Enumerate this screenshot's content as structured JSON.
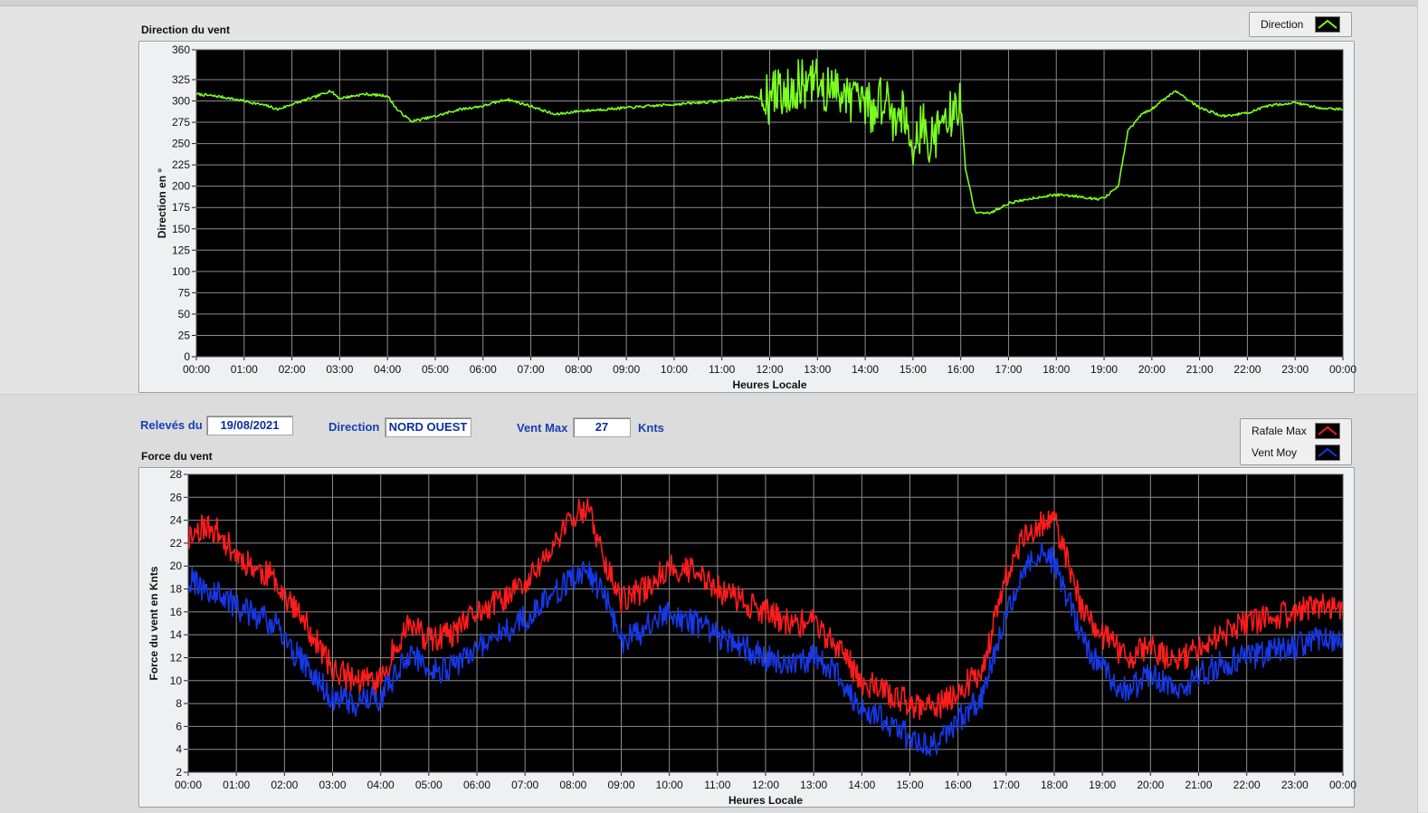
{
  "chart_data": [
    {
      "type": "line",
      "title": "Direction du vent",
      "xlabel": "Heures Locale",
      "ylabel": "Direction en °",
      "ylim": [
        0,
        360
      ],
      "yticks": [
        0,
        25,
        50,
        75,
        100,
        125,
        150,
        175,
        200,
        225,
        250,
        275,
        300,
        325,
        360
      ],
      "xticks": [
        "00:00",
        "01:00",
        "02:00",
        "03:00",
        "04:00",
        "05:00",
        "06:00",
        "07:00",
        "08:00",
        "09:00",
        "10:00",
        "11:00",
        "12:00",
        "13:00",
        "14:00",
        "15:00",
        "16:00",
        "17:00",
        "18:00",
        "19:00",
        "20:00",
        "21:00",
        "22:00",
        "23:00",
        "00:00"
      ],
      "xlim": [
        0,
        24
      ],
      "grid": true,
      "legend": "top-right",
      "series": [
        {
          "name": "Direction",
          "color": "#7cff1e",
          "x": [
            0,
            0.5,
            1,
            1.5,
            1.7,
            2,
            2.5,
            2.8,
            3,
            3.5,
            4,
            4.2,
            4.5,
            5,
            5.5,
            6,
            6.5,
            7,
            7.5,
            8,
            8.5,
            9,
            9.5,
            10,
            10.5,
            11,
            11.5,
            12,
            12.2,
            12.5,
            13,
            13.3,
            13.6,
            13.8,
            14,
            14.2,
            14.4,
            14.6,
            14.8,
            15,
            15.2,
            15.4,
            15.6,
            15.8,
            15.95,
            16,
            16.1,
            16.3,
            16.6,
            17,
            17.5,
            18,
            18.5,
            18.8,
            19,
            19.3,
            19.5,
            19.8,
            20,
            20.2,
            20.5,
            21,
            21.5,
            22,
            22.5,
            23,
            23.5,
            24
          ],
          "values": [
            308,
            305,
            300,
            294,
            290,
            296,
            305,
            312,
            303,
            308,
            306,
            290,
            276,
            282,
            290,
            294,
            302,
            294,
            284,
            288,
            290,
            292,
            294,
            296,
            298,
            300,
            305,
            302,
            312,
            318,
            320,
            310,
            315,
            295,
            300,
            285,
            310,
            280,
            290,
            255,
            270,
            252,
            275,
            282,
            290,
            300,
            220,
            170,
            168,
            180,
            186,
            190,
            188,
            185,
            186,
            200,
            265,
            285,
            290,
            300,
            312,
            292,
            282,
            286,
            295,
            298,
            292,
            290
          ]
        }
      ]
    },
    {
      "type": "line",
      "title": "Force du vent",
      "xlabel": "Heures Locale",
      "ylabel": "Force du vent en Knts",
      "ylim": [
        2,
        28
      ],
      "yticks": [
        2,
        4,
        6,
        8,
        10,
        12,
        14,
        16,
        18,
        20,
        22,
        24,
        26,
        28
      ],
      "xticks": [
        "00:00",
        "01:00",
        "02:00",
        "03:00",
        "04:00",
        "05:00",
        "06:00",
        "07:00",
        "08:00",
        "09:00",
        "10:00",
        "11:00",
        "12:00",
        "13:00",
        "14:00",
        "15:00",
        "16:00",
        "17:00",
        "18:00",
        "19:00",
        "20:00",
        "21:00",
        "22:00",
        "23:00",
        "00:00"
      ],
      "xlim": [
        0,
        24
      ],
      "grid": true,
      "legend": "top-right",
      "series": [
        {
          "name": "Rafale Max",
          "color": "#ff1c1c",
          "x": [
            0,
            0.3,
            0.6,
            1,
            1.5,
            1.8,
            2,
            2.5,
            3,
            3.5,
            4,
            4.3,
            4.6,
            5,
            5.5,
            6,
            6.5,
            7,
            7.5,
            8,
            8.3,
            8.7,
            9,
            9.5,
            10,
            10.5,
            11,
            11.5,
            12,
            12.5,
            13,
            13.5,
            14,
            14.5,
            15,
            15.5,
            16,
            16.5,
            17,
            17.3,
            17.6,
            18,
            18.3,
            18.6,
            19,
            19.5,
            20,
            20.5,
            21,
            21.5,
            22,
            22.5,
            23,
            23.5,
            24
          ],
          "values": [
            22.5,
            23.5,
            23,
            21,
            19.5,
            19,
            17.5,
            14.5,
            11,
            10,
            10,
            13,
            15,
            13.5,
            14,
            16,
            17,
            18.5,
            21,
            24.5,
            25,
            20,
            17,
            18,
            20,
            19.5,
            18,
            17,
            16,
            15,
            15,
            13,
            10,
            9,
            8,
            7.5,
            9,
            11,
            19,
            22,
            23.5,
            24,
            20,
            16,
            14,
            12,
            13,
            11.5,
            13,
            14,
            15,
            15.5,
            16,
            16.5,
            16
          ]
        },
        {
          "name": "Vent Moy",
          "color": "#1638e6",
          "x": [
            0,
            0.3,
            0.6,
            1,
            1.5,
            1.8,
            2,
            2.5,
            3,
            3.5,
            4,
            4.3,
            4.6,
            5,
            5.5,
            6,
            6.5,
            7,
            7.5,
            8,
            8.3,
            8.7,
            9,
            9.5,
            10,
            10.5,
            11,
            11.5,
            12,
            12.5,
            13,
            13.5,
            14,
            14.5,
            15,
            15.5,
            16,
            16.5,
            17,
            17.3,
            17.6,
            18,
            18.3,
            18.6,
            19,
            19.5,
            20,
            20.5,
            21,
            21.5,
            22,
            22.5,
            23,
            23.5,
            24
          ],
          "values": [
            19,
            18,
            17.5,
            16.5,
            15.5,
            15,
            13.5,
            11,
            8.5,
            8,
            8.5,
            10.5,
            12.5,
            11,
            11,
            13,
            14,
            15.5,
            17,
            19,
            19.5,
            17,
            13.5,
            14.5,
            16,
            15,
            14,
            13,
            12,
            11.5,
            12,
            10.5,
            7.5,
            6.5,
            5,
            4.5,
            6.5,
            8.5,
            16,
            19,
            21,
            20.5,
            17,
            13.5,
            11,
            9,
            10.5,
            9,
            10.5,
            11.5,
            12,
            12.5,
            13,
            13.5,
            13.5
          ]
        }
      ]
    }
  ],
  "controls": {
    "releves_label": "Relevés du",
    "releves_value": "19/08/2021",
    "direction_label": "Direction",
    "direction_value": "NORD OUEST",
    "ventmax_label": "Vent Max",
    "ventmax_value": "27",
    "ventmax_unit": "Knts"
  },
  "colors": {
    "plot_bg": "#000000",
    "grid": "#8c8c8c",
    "direction": "#7cff1e",
    "rafale": "#ff1c1c",
    "moy": "#1638e6",
    "control_text": "#1640b4"
  }
}
